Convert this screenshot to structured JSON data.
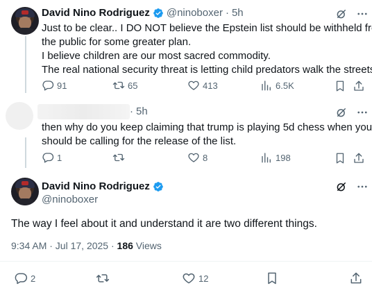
{
  "tweet1": {
    "name": "David Nino Rodriguez",
    "handle": "@ninoboxer",
    "time": "5h",
    "lines": [
      "Just to be clear.. I DO NOT believe the Epstein list should be withheld from",
      "the public for some greater plan.",
      "I believe children are our most sacred commodity.",
      "The real national security threat is letting child predators walk the streets."
    ],
    "replies": "91",
    "reposts": "65",
    "likes": "413",
    "views": "6.5K"
  },
  "tweet2": {
    "time": "5h",
    "lines": [
      "then why do you keep claiming that trump is playing 5d chess when you",
      "should be calling for the release of the list."
    ],
    "replies": "1",
    "reposts": "",
    "likes": "8",
    "views": "198"
  },
  "main": {
    "name": "David Nino Rodriguez",
    "handle": "@ninoboxer",
    "text": "The way I feel about it and understand it are two different things.",
    "timestamp": "9:34 AM · Jul 17, 2025 · ",
    "views_count": "186",
    "views_label": " Views",
    "replies": "2",
    "reposts": "",
    "likes": "12"
  },
  "colors": {
    "verified": "#1d9bf0",
    "text": "#0f1419",
    "secondary": "#536471",
    "thread_line": "#cfd9de"
  }
}
